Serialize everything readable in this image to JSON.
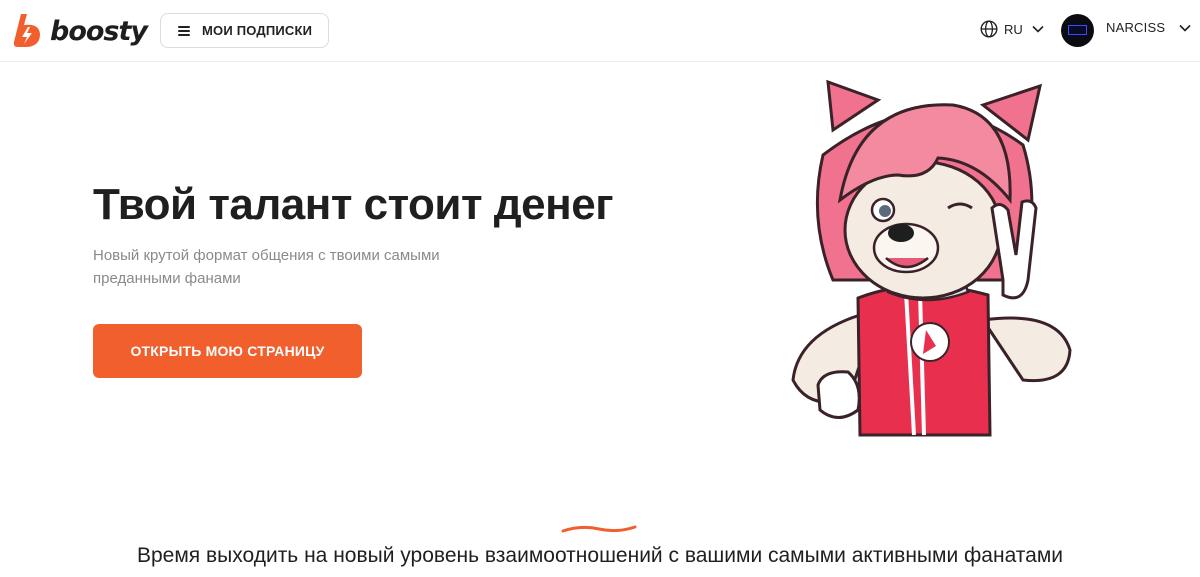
{
  "brand": {
    "name": "boosty",
    "logo_icon": "boosty-bolt-logo"
  },
  "header": {
    "subscriptions_label": "МОИ ПОДПИСКИ",
    "language": "RU",
    "user_name": "NARCISS"
  },
  "hero": {
    "title": "Твой талант стоит денег",
    "subtitle": "Новый крутой формат общения с твоими самыми преданными фанами",
    "cta_label": "ОТКРЫТЬ МОЮ СТРАНИЦУ",
    "mascot_badge": "b"
  },
  "section": {
    "tagline": "Время выходить на новый уровень взаимоотношений с вашими самыми активными фанатами"
  },
  "colors": {
    "accent": "#f15f2c",
    "mascot_hair": "#f0728e",
    "mascot_shirt": "#e8304e"
  }
}
